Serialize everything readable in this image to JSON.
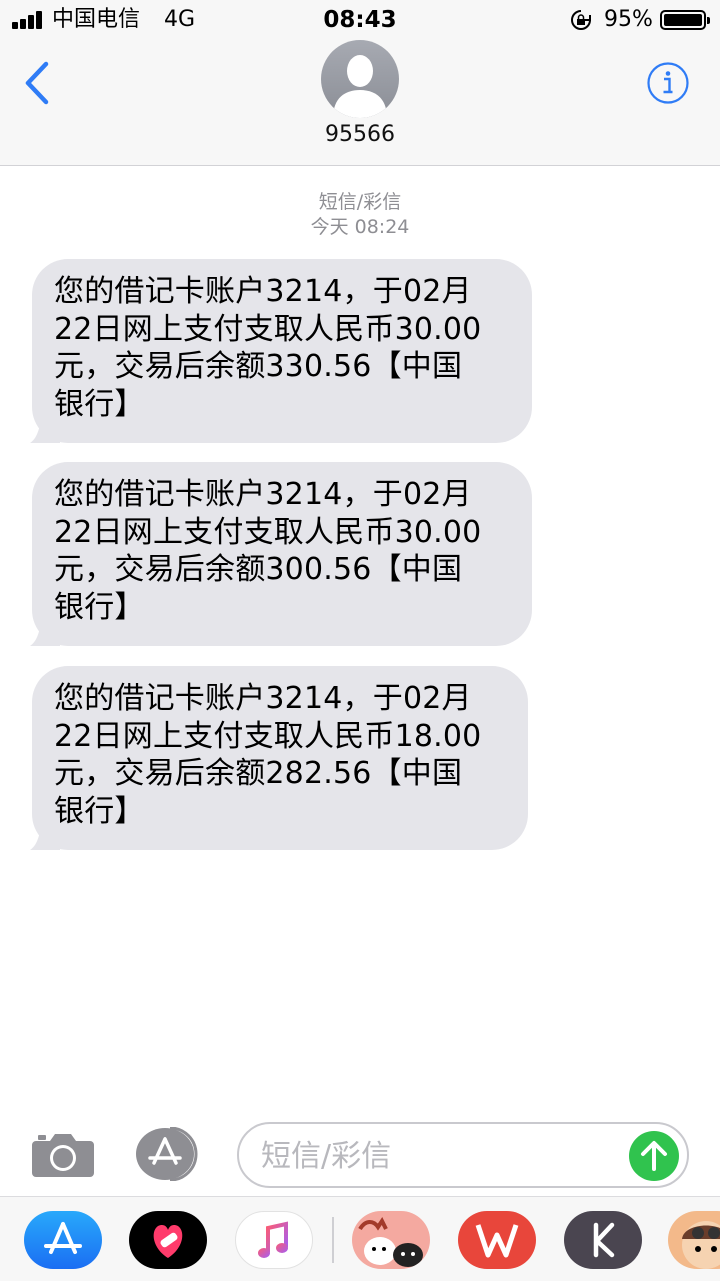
{
  "status_bar": {
    "carrier": "中国电信",
    "network": "4G",
    "time": "08:43",
    "battery_percent": "95%",
    "battery_level": 0.95,
    "signal_bars": 4
  },
  "header": {
    "contact": "95566",
    "avatar_icon": "person-silhouette-icon",
    "back_icon": "chevron-left-icon",
    "info_icon": "info-icon",
    "accent_color": "#2f7cf6"
  },
  "conversation": {
    "message_type": "短信/彩信",
    "timestamp": "今天 08:24",
    "messages": [
      {
        "text": "您的借记卡账户3214，于02月\n22日网上支付支取人民币30.00\n元，交易后余额330.56【中国\n银行】"
      },
      {
        "text": "您的借记卡账户3214，于02月\n22日网上支付支取人民币30.00\n元，交易后余额300.56【中国\n银行】"
      },
      {
        "text": "您的借记卡账户3214，于02月\n22日网上支付支取人民币18.00\n元，交易后余额282.56【中国\n银行】"
      }
    ]
  },
  "input_bar": {
    "placeholder": "短信/彩信",
    "value": "",
    "camera_icon": "camera-icon",
    "appstore_icon": "app-store-icon",
    "send_icon": "arrow-up-icon",
    "send_color": "#30c34e"
  },
  "app_drawer": {
    "apps": [
      {
        "name": "app-store-icon"
      },
      {
        "name": "heart-icon"
      },
      {
        "name": "music-note-icon"
      },
      {
        "name": "sticker-animals-icon"
      },
      {
        "name": "wps-icon"
      },
      {
        "name": "k-icon"
      },
      {
        "name": "cartoon-character-icon"
      }
    ]
  }
}
